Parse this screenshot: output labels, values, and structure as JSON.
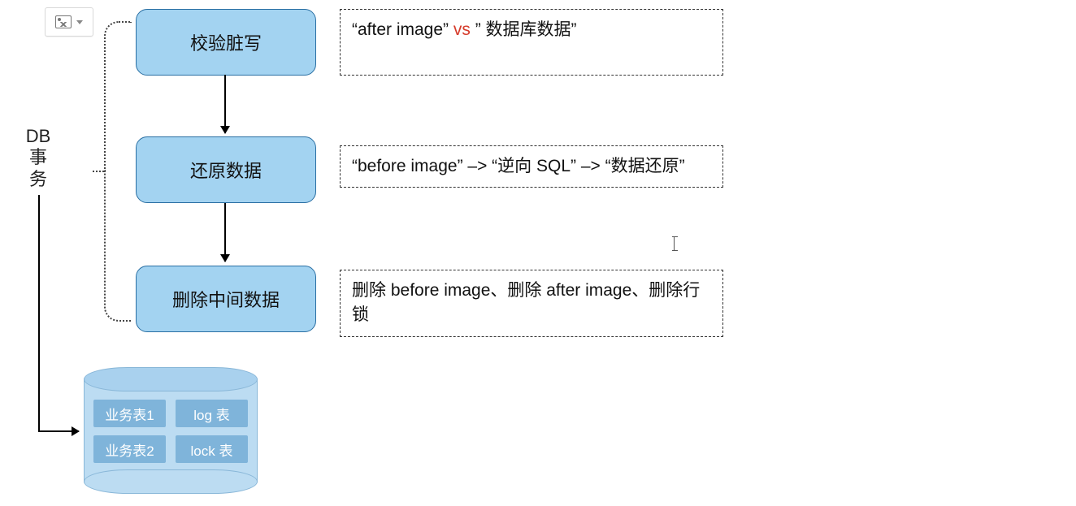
{
  "toolbar": {
    "image_button_name": "image-toolbar-button"
  },
  "side_label": "DB\n事\n务",
  "steps": [
    {
      "label": "校验脏写"
    },
    {
      "label": "还原数据"
    },
    {
      "label": "删除中间数据"
    }
  ],
  "descriptions": {
    "d1_prefix": "“after  image”  ",
    "d1_vs": "vs",
    "d1_suffix": " ” 数据库数据”",
    "d2": "“before image” –> “逆向 SQL” –> “数据还原”",
    "d3": "删除 before image、删除 after image、删除行锁"
  },
  "db_tables": [
    "业务表1",
    "log 表",
    "业务表2",
    "lock 表"
  ]
}
